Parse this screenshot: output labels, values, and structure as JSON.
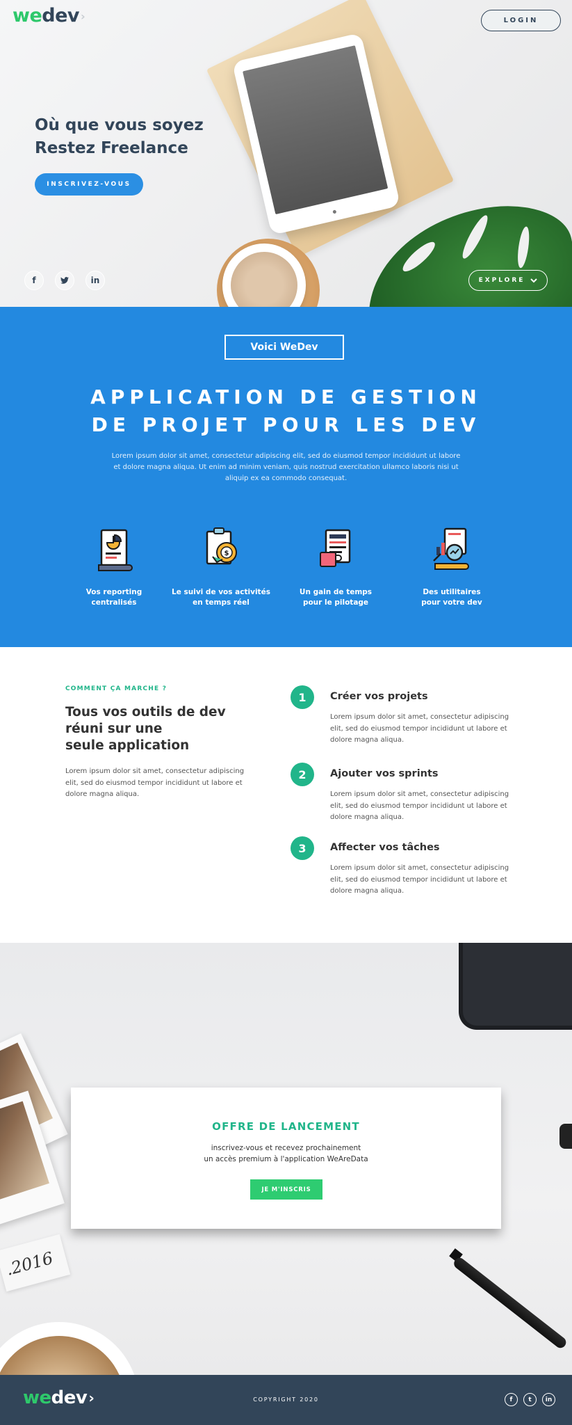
{
  "brand": {
    "we": "we",
    "dev": "dev",
    "chevron": "›"
  },
  "header": {
    "login_label": "LOGIN"
  },
  "hero": {
    "title_line1": "Où que vous soyez",
    "title_line2_prefix": "Restez ",
    "title_line2_strong": "Freelance",
    "cta_label": "INSCRIVEZ-VOUS",
    "explore_label": "EXPLORE",
    "social": [
      {
        "icon": "facebook-icon",
        "glyph": "f"
      },
      {
        "icon": "twitter-icon",
        "glyph": "🐦"
      },
      {
        "icon": "linkedin-icon",
        "glyph": "in"
      }
    ]
  },
  "intro": {
    "badge": "Voici WeDev",
    "title_line1": "APPLICATION DE GESTION",
    "title_line2": "DE PROJET POUR LES DEV",
    "description": "Lorem ipsum dolor sit amet, consectetur adipiscing elit, sed do eiusmod tempor incididunt ut labore et dolore magna aliqua. Ut enim ad minim veniam, quis nostrud exercitation ullamco laboris nisi ut aliquip ex ea commodo consequat."
  },
  "features": [
    {
      "icon": "report-document-icon",
      "line1": "Vos reporting",
      "line2": "centralisés"
    },
    {
      "icon": "money-tracking-icon",
      "line1": "Le suivi de vos activités",
      "line2": "en temps réel"
    },
    {
      "icon": "newspaper-coffee-icon",
      "line1": "Un gain de temps",
      "line2": "pour le pilotage"
    },
    {
      "icon": "analytics-tools-icon",
      "line1": "Des  utilitaires",
      "line2": "pour votre dev"
    }
  ],
  "how": {
    "kicker": "COMMENT ÇA MARCHE ?",
    "title_line1": "Tous vos outils de dev",
    "title_line2": "réuni sur une",
    "title_line3": "seule application",
    "description": "Lorem ipsum dolor sit amet, consectetur adipiscing elit, sed do eiusmod tempor incididunt ut labore et dolore magna aliqua.",
    "steps": [
      {
        "number": "1",
        "title": "Créer vos projets",
        "text": "Lorem ipsum dolor sit amet, consectetur adipiscing elit, sed do eiusmod tempor incididunt ut labore et dolore magna aliqua."
      },
      {
        "number": "2",
        "title": "Ajouter vos sprints",
        "text": "Lorem ipsum dolor sit amet, consectetur adipiscing elit, sed do eiusmod tempor incididunt ut labore et dolore magna aliqua."
      },
      {
        "number": "3",
        "title": "Affecter vos tâches",
        "text": "Lorem ipsum dolor sit amet, consectetur adipiscing elit, sed do eiusmod tempor incididunt ut labore et dolore magna aliqua."
      }
    ]
  },
  "offer": {
    "photo_note": ".2016",
    "title": "OFFRE DE LANCEMENT",
    "line1": "inscrivez-vous et recevez prochainement",
    "line2": "un accès premium à l'application WeAreData",
    "cta_label": "JE M'INSCRIS"
  },
  "footer": {
    "copyright": "COPYRIGHT 2020",
    "social": [
      {
        "icon": "facebook-icon",
        "glyph": "f"
      },
      {
        "icon": "twitter-icon",
        "glyph": "t"
      },
      {
        "icon": "linkedin-icon",
        "glyph": "in"
      }
    ]
  },
  "colors": {
    "brand_green": "#2ec86b",
    "brand_navy": "#324559",
    "primary_blue": "#2389e0",
    "teal_accent": "#21b58a",
    "offer_button": "#2ecc71"
  }
}
